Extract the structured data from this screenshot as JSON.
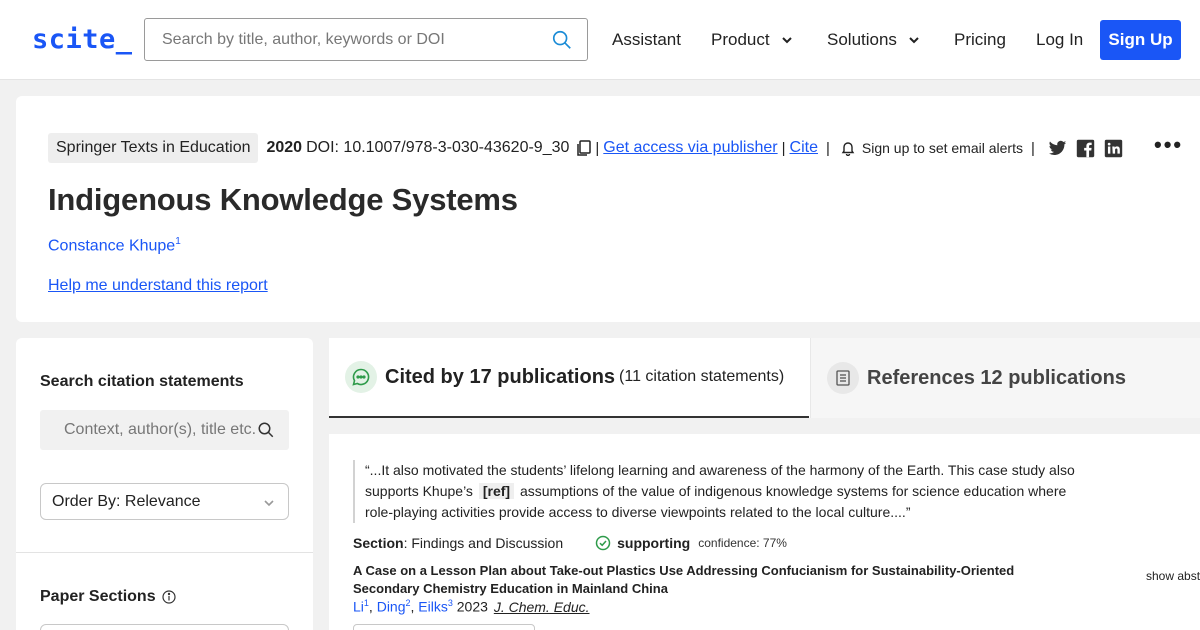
{
  "nav": {
    "logo": "scite_",
    "search_placeholder": "Search by title, author, keywords or DOI",
    "items": [
      "Assistant",
      "Product",
      "Solutions",
      "Pricing",
      "Log In"
    ],
    "signup": "Sign Up",
    "accent_color": "#1a56f6"
  },
  "header": {
    "journal": "Springer Texts in Education",
    "year": "2020",
    "doi": "DOI: 10.1007/978-3-030-43620-9_30",
    "sep": "|",
    "access_link": "Get access via publisher",
    "cite_link": "Cite",
    "alerts": "Sign up to set email alerts",
    "title": "Indigenous Knowledge Systems",
    "author": "Constance Khupe",
    "author_sup": "1",
    "help_link": "Help me understand this report",
    "more": "•••",
    "icons": [
      "copy-icon",
      "bell-icon",
      "twitter-icon",
      "facebook-icon",
      "linkedin-icon"
    ]
  },
  "left": {
    "search_heading": "Search citation statements",
    "search_placeholder": "Context, author(s), title etc.",
    "order_by": "Order By: Relevance",
    "sections_heading": "Paper Sections"
  },
  "tabs": {
    "cited_main": "Cited by 17 publications",
    "cited_sub": "(11 citation statements)",
    "refs_main": "References 12 publications"
  },
  "citation": {
    "quote_pre": "“...It also motivated the students’ lifelong learning and awareness of the harmony of the Earth. This case study also supports Khupe’s",
    "ref_tag": "[ref]",
    "quote_post": "assumptions of the value of indigenous knowledge systems for science education where role-playing activities provide access to diverse viewpoints related to the local culture....”",
    "section_label": "Section",
    "section_value": ": Findings and Discussion",
    "supporting": "supporting",
    "confidence": "confidence: 77%",
    "title": "A Case on a Lesson Plan about Take-out Plastics Use Addressing Confucianism for Sustainability-Oriented Secondary Chemistry Education in Mainland China",
    "authors": [
      {
        "name": "Li",
        "sup": "1"
      },
      {
        "name": "Ding",
        "sup": "2"
      },
      {
        "name": "Eilks",
        "sup": "3"
      }
    ],
    "year": "2023",
    "journal": "J. Chem. Educ.",
    "show_abstract": "show abst",
    "supporting_color": "#2e9b4a"
  }
}
